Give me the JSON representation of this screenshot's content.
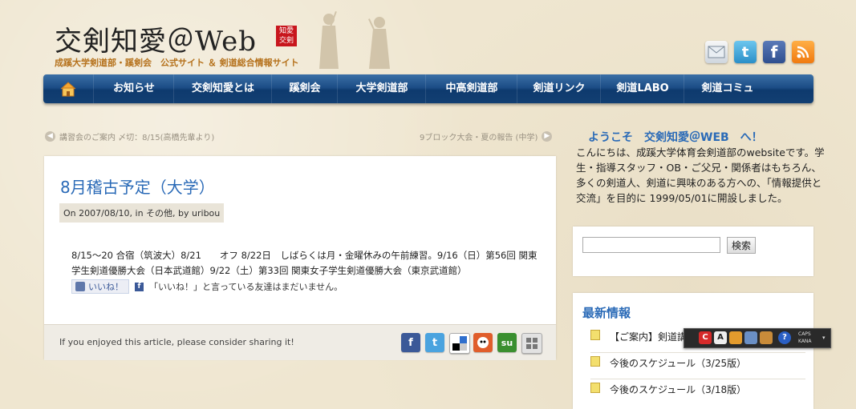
{
  "header": {
    "logo_title": "交剣知愛＠Web",
    "logo_seal": "知愛交剣",
    "tagline": "成蹊大学剣道部・蹊剣会　公式サイト ＆ 剣道総合情報サイト",
    "social": [
      {
        "name": "mail-icon"
      },
      {
        "name": "twitter-icon",
        "glyph": "t"
      },
      {
        "name": "facebook-icon",
        "glyph": "f"
      },
      {
        "name": "rss-icon"
      }
    ]
  },
  "nav": {
    "home_icon": "home-icon",
    "items": [
      "お知らせ",
      "交剣知愛とは",
      "蹊剣会",
      "大学剣道部",
      "中高剣道部",
      "剣道リンク",
      "剣道LABO",
      "剣道コミュ"
    ]
  },
  "postnav": {
    "prev": "講習会のご案内 〆切：8/15(高橋先輩より)",
    "next": "9ブロック大会・夏の報告 (中学)"
  },
  "article": {
    "title": "8月稽古予定（大学）",
    "meta": "On 2007/08/10, in その他, by uribou",
    "body": "8/15～20 合宿（筑波大）8/21　　オフ 8/22日　しばらくは月・金曜休みの午前練習。9/16（日）第56回 関東学生剣道優勝大会（日本武道館）9/22（土）第33回 関東女子学生剣道優勝大会（東京武道館）",
    "like_label": "いいね！",
    "like_note": "「いいね！」と言っている友達はまだいません。",
    "share_text": "If you enjoyed this article, please consider sharing it!",
    "share_icons": [
      {
        "name": "facebook-share-icon",
        "glyph": "f",
        "color": "#3b5998"
      },
      {
        "name": "twitter-share-icon",
        "glyph": "t",
        "color": "#4aa3df"
      },
      {
        "name": "delicious-share-icon",
        "glyph": "",
        "color": "#2f6fcd"
      },
      {
        "name": "hatena-share-icon",
        "glyph": "",
        "color": "#e05d2b"
      },
      {
        "name": "stumbleupon-share-icon",
        "glyph": "su",
        "color": "#3a8f2f"
      },
      {
        "name": "share-more-icon",
        "glyph": "",
        "color": "#9a9a9a"
      }
    ]
  },
  "sidebar": {
    "welcome_title": "ようこそ　交剣知愛＠WEB　へ！",
    "welcome_text": "こんにちは、成蹊大学体育会剣道部のwebsiteです。学生・指導スタッフ・OB・ご父兄・関係者はもちろん、多くの剣道人、剣道に興味のある方への、「情報提供と交流」を目的に 1999/05/01に開設しました。",
    "search_button": "検索",
    "search_value": "",
    "news_title": "最新情報",
    "news_items": [
      "【ご案内】剣道講",
      "今後のスケジュール（3/25版）",
      "今後のスケジュール（3/18版）"
    ]
  },
  "ime_bar": {
    "caps": "CAPS",
    "kana": "KANA"
  }
}
